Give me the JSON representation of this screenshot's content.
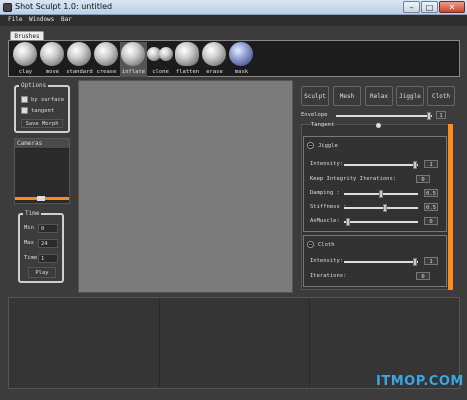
{
  "window": {
    "title": "Shot Sculpt 1.0: untitled",
    "min": "–",
    "max": "□",
    "close": "✕"
  },
  "menu": {
    "items": [
      "File",
      "Windows",
      "Bar"
    ]
  },
  "brush_tab": {
    "label": "Brushes"
  },
  "brushes": [
    {
      "label": "clay",
      "selected": false
    },
    {
      "label": "move",
      "selected": false
    },
    {
      "label": "standard",
      "selected": false
    },
    {
      "label": "crease",
      "selected": false
    },
    {
      "label": "inflate",
      "selected": true
    },
    {
      "label": "clone",
      "selected": false
    },
    {
      "label": "flatten",
      "selected": false
    },
    {
      "label": "erase",
      "selected": false
    },
    {
      "label": "mask",
      "selected": false
    }
  ],
  "options": {
    "legend": "Options",
    "by_surface": "by surface",
    "tangent": "tangent",
    "save_morph": "Save Morph"
  },
  "cameras": {
    "label": "Cameras"
  },
  "time": {
    "legend": "Time",
    "min_label": "Min",
    "min_value": "0",
    "max_label": "Max",
    "max_value": "24",
    "time_label": "Time",
    "time_value": "1",
    "play": "Play"
  },
  "right_tabs": [
    "Sculpt",
    "Mesh",
    "Relax",
    "Jiggle",
    "Cloth"
  ],
  "envelope": {
    "label": "Envelope",
    "value": "1",
    "fraction": 0.97
  },
  "panel_top_label": "Tangent",
  "jiggle": {
    "title": "Jiggle",
    "rows": [
      {
        "label": "Intensity:",
        "value": "1",
        "fraction": 0.97,
        "slider": true
      },
      {
        "label": "Keep Integrity Iterations:",
        "value": "0",
        "slider": false
      },
      {
        "label": "Damping :",
        "value": "0.5",
        "fraction": 0.5,
        "slider": true
      },
      {
        "label": "Stiffness :",
        "value": "0.5",
        "fraction": 0.55,
        "slider": true
      },
      {
        "label": "AsMuscle:",
        "value": "0",
        "fraction": 0.05,
        "slider": true
      }
    ]
  },
  "cloth": {
    "title": "Cloth",
    "rows": [
      {
        "label": "Intensity:",
        "value": "1",
        "fraction": 0.97,
        "slider": true
      },
      {
        "label": "Iterations:",
        "value": "0",
        "slider": false
      }
    ]
  },
  "watermark": {
    "text": "ITMOP.COM"
  }
}
